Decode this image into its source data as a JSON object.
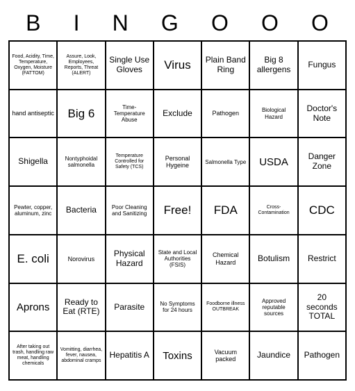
{
  "header": [
    "B",
    "I",
    "N",
    "G",
    "O",
    "O",
    "O"
  ],
  "cells": [
    {
      "t": "Food, Acidity, Time, Temperature, Oxygen, Moisture (FATTOM)",
      "s": "xs"
    },
    {
      "t": "Assure, Look, Employees, Reports, Threat (ALERT)",
      "s": "xs"
    },
    {
      "t": "Single Use Gloves",
      "s": "med"
    },
    {
      "t": "Virus",
      "s": "xbig"
    },
    {
      "t": "Plain Band Ring",
      "s": "med"
    },
    {
      "t": "Big 8 allergens",
      "s": "med"
    },
    {
      "t": "Fungus",
      "s": "med"
    },
    {
      "t": "hand antiseptic",
      "s": ""
    },
    {
      "t": "Big 6",
      "s": "xbig"
    },
    {
      "t": "Time-Temperature Abuse",
      "s": "sm"
    },
    {
      "t": "Exclude",
      "s": "med"
    },
    {
      "t": "Pathogen",
      "s": ""
    },
    {
      "t": "Biological Hazard",
      "s": "sm"
    },
    {
      "t": "Doctor's Note",
      "s": "med"
    },
    {
      "t": "Shigella",
      "s": "med"
    },
    {
      "t": "Nontyphoidal salmonella",
      "s": "sm"
    },
    {
      "t": "Temperature Controlled for Safety (TCS)",
      "s": "xs"
    },
    {
      "t": "Personal Hygeine",
      "s": ""
    },
    {
      "t": "Salmonella Type",
      "s": "sm"
    },
    {
      "t": "USDA",
      "s": "big"
    },
    {
      "t": "Danger Zone",
      "s": "med"
    },
    {
      "t": "Pewter, copper, aluminum, zinc",
      "s": "sm"
    },
    {
      "t": "Bacteria",
      "s": "med"
    },
    {
      "t": "Poor Cleaning and Sanitizing",
      "s": "sm"
    },
    {
      "t": "Free!",
      "s": "xbig"
    },
    {
      "t": "FDA",
      "s": "xbig"
    },
    {
      "t": "Cross-Contamination",
      "s": "xs"
    },
    {
      "t": "CDC",
      "s": "xbig"
    },
    {
      "t": "E. coli",
      "s": "xbig"
    },
    {
      "t": "Norovirus",
      "s": ""
    },
    {
      "t": "Physical Hazard",
      "s": "med"
    },
    {
      "t": "State and Local Authorities (FSIS)",
      "s": "sm"
    },
    {
      "t": "Chemical Hazard",
      "s": ""
    },
    {
      "t": "Botulism",
      "s": "med"
    },
    {
      "t": "Restrict",
      "s": "med"
    },
    {
      "t": "Aprons",
      "s": "big"
    },
    {
      "t": "Ready to Eat (RTE)",
      "s": "med"
    },
    {
      "t": "Parasite",
      "s": "med"
    },
    {
      "t": "No Symptoms for 24 hours",
      "s": "sm"
    },
    {
      "t": "Foodborne illness OUTBREAK",
      "s": "xs"
    },
    {
      "t": "Approved reputable sources",
      "s": "sm"
    },
    {
      "t": "20 seconds TOTAL",
      "s": "med"
    },
    {
      "t": "After taking out trash, handling raw meat, handling chemicals",
      "s": "xs"
    },
    {
      "t": "Vomitting, diarrhea, fever, nausea, abdominal cramps",
      "s": "xs"
    },
    {
      "t": "Hepatitis A",
      "s": "med"
    },
    {
      "t": "Toxins",
      "s": "big"
    },
    {
      "t": "Vacuum packed",
      "s": ""
    },
    {
      "t": "Jaundice",
      "s": "med"
    },
    {
      "t": "Pathogen",
      "s": "med"
    }
  ]
}
